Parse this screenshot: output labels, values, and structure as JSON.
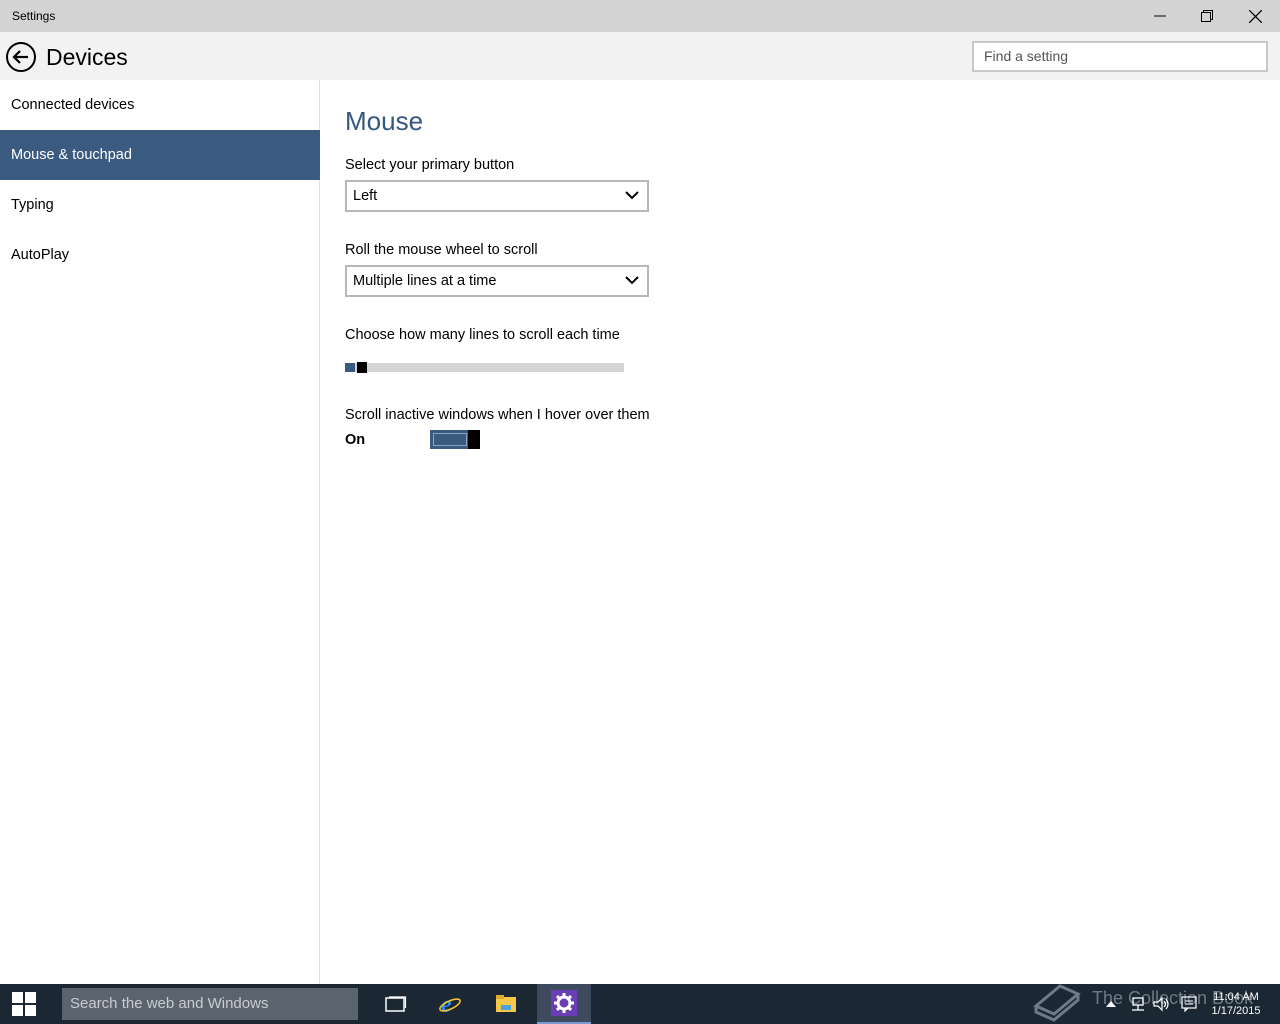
{
  "window": {
    "title": "Settings",
    "minimize_icon": "minimize-icon",
    "restore_icon": "restore-icon",
    "close_icon": "close-icon"
  },
  "header": {
    "back_icon": "back-arrow-icon",
    "title": "Devices",
    "search_placeholder": "Find a setting"
  },
  "sidebar": {
    "items": [
      {
        "label": "Connected devices",
        "active": false
      },
      {
        "label": "Mouse & touchpad",
        "active": true
      },
      {
        "label": "Typing",
        "active": false
      },
      {
        "label": "AutoPlay",
        "active": false
      }
    ]
  },
  "main": {
    "section_title": "Mouse",
    "primary_button": {
      "label": "Select your primary button",
      "value": "Left"
    },
    "wheel_scroll": {
      "label": "Roll the mouse wheel to scroll",
      "value": "Multiple lines at a time"
    },
    "lines_slider": {
      "label": "Choose how many lines to scroll each time",
      "level_fraction": 0.03
    },
    "inactive_scroll": {
      "label": "Scroll inactive windows when I hover over them",
      "state": "On",
      "enabled": true
    }
  },
  "taskbar": {
    "search_placeholder": "Search the web and Windows",
    "apps": [
      {
        "name": "task-view-icon",
        "active": false
      },
      {
        "name": "internet-explorer-icon",
        "active": false
      },
      {
        "name": "file-explorer-icon",
        "active": false
      },
      {
        "name": "settings-gear-icon",
        "active": true
      }
    ],
    "watermark": "The Collection Book",
    "time": "11:04 AM",
    "date": "1/17/2015",
    "colors": {
      "accent": "#3b5a80",
      "taskbar": "#1c2734"
    }
  }
}
